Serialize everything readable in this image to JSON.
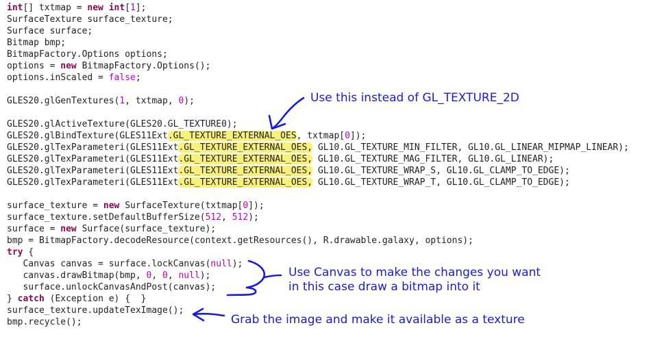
{
  "code": {
    "lines": [
      [
        {
          "t": "int",
          "c": "kw"
        },
        {
          "t": "[] txtmap = "
        },
        {
          "t": "new",
          "c": "kw"
        },
        {
          "t": " "
        },
        {
          "t": "int",
          "c": "kw"
        },
        {
          "t": "["
        },
        {
          "t": "1",
          "c": "num"
        },
        {
          "t": "];"
        }
      ],
      [
        {
          "t": "SurfaceTexture surface_texture;"
        }
      ],
      [
        {
          "t": "Surface surface;"
        }
      ],
      [
        {
          "t": "Bitmap bmp;"
        }
      ],
      [
        {
          "t": "BitmapFactory.Options options;"
        }
      ],
      [
        {
          "t": "options = "
        },
        {
          "t": "new",
          "c": "kw"
        },
        {
          "t": " BitmapFactory.Options();"
        }
      ],
      [
        {
          "t": "options.inScaled = "
        },
        {
          "t": "false",
          "c": "bool"
        },
        {
          "t": ";"
        }
      ],
      [],
      [
        {
          "t": "GLES20.glGenTextures("
        },
        {
          "t": "1",
          "c": "num"
        },
        {
          "t": ", txtmap, "
        },
        {
          "t": "0",
          "c": "num"
        },
        {
          "t": ");"
        }
      ],
      [],
      [
        {
          "t": "GLES20.glActiveTexture(GLES20.GL_TEXTURE0);"
        }
      ],
      [
        {
          "t": "GLES20.glBindTexture(GLES11Ext"
        },
        {
          "t": ".GL_TEXTURE_EXTERNAL_OES",
          "c": "hl"
        },
        {
          "t": ", txtmap["
        },
        {
          "t": "0",
          "c": "num"
        },
        {
          "t": "]);"
        }
      ],
      [
        {
          "t": "GLES20.glTexParameteri(GLES11Ext"
        },
        {
          "t": ".GL_TEXTURE_EXTERNAL_OES,",
          "c": "hl"
        },
        {
          "t": " GL10.GL_TEXTURE_MIN_FILTER, GL10.GL_LINEAR_MIPMAP_LINEAR);"
        }
      ],
      [
        {
          "t": "GLES20.glTexParameteri(GLES11Ext"
        },
        {
          "t": ".GL_TEXTURE_EXTERNAL_OES,",
          "c": "hl"
        },
        {
          "t": " GL10.GL_TEXTURE_MAG_FILTER, GL10.GL_LINEAR);"
        }
      ],
      [
        {
          "t": "GLES20.glTexParameteri(GLES11Ext"
        },
        {
          "t": ".GL_TEXTURE_EXTERNAL_OES,",
          "c": "hl"
        },
        {
          "t": " GL10.GL_TEXTURE_WRAP_S, GL10.GL_CLAMP_TO_EDGE);"
        }
      ],
      [
        {
          "t": "GLES20.glTexParameteri(GLES11Ext"
        },
        {
          "t": ".GL_TEXTURE_EXTERNAL_OES,",
          "c": "hl"
        },
        {
          "t": " GL10.GL_TEXTURE_WRAP_T, GL10.GL_CLAMP_TO_EDGE);"
        }
      ],
      [],
      [
        {
          "t": "surface_texture = "
        },
        {
          "t": "new",
          "c": "kw"
        },
        {
          "t": " SurfaceTexture(txtmap["
        },
        {
          "t": "0",
          "c": "num"
        },
        {
          "t": "]);"
        }
      ],
      [
        {
          "t": "surface_texture.setDefaultBufferSize("
        },
        {
          "t": "512",
          "c": "num"
        },
        {
          "t": ", "
        },
        {
          "t": "512",
          "c": "num"
        },
        {
          "t": ");"
        }
      ],
      [
        {
          "t": "surface = "
        },
        {
          "t": "new",
          "c": "kw"
        },
        {
          "t": " Surface(surface_texture);"
        }
      ],
      [
        {
          "t": "bmp = BitmapFactory.decodeResource(context.getResources(), R.drawable.galaxy, options);"
        }
      ],
      [
        {
          "t": "try",
          "c": "kw"
        },
        {
          "t": " {"
        }
      ],
      [
        {
          "t": "   Canvas canvas = surface.lockCanvas("
        },
        {
          "t": "null",
          "c": "bool"
        },
        {
          "t": ");"
        }
      ],
      [
        {
          "t": "   canvas.drawBitmap(bmp, "
        },
        {
          "t": "0",
          "c": "num"
        },
        {
          "t": ", "
        },
        {
          "t": "0",
          "c": "num"
        },
        {
          "t": ", "
        },
        {
          "t": "null",
          "c": "bool"
        },
        {
          "t": ");"
        }
      ],
      [
        {
          "t": "   surface.unlockCanvasAndPost(canvas);"
        }
      ],
      [
        {
          "t": "} "
        },
        {
          "t": "catch",
          "c": "kw"
        },
        {
          "t": " (Exception e) {  }"
        }
      ],
      [
        {
          "t": "surface_texture.updateTexImage();"
        }
      ],
      [
        {
          "t": "bmp.recycle();"
        }
      ]
    ]
  },
  "annotations": {
    "texture_note": "Use this instead of GL_TEXTURE_2D",
    "canvas_note_line1": "Use Canvas to make the changes you want",
    "canvas_note_line2": "in this case draw a bitmap into it",
    "image_note": "Grab the image and make it available as a texture"
  },
  "colors": {
    "annotation_ink": "#1a1adc",
    "highlight": "#f7f07a",
    "keyword": "#8b0a50",
    "literal": "#c000c0"
  }
}
